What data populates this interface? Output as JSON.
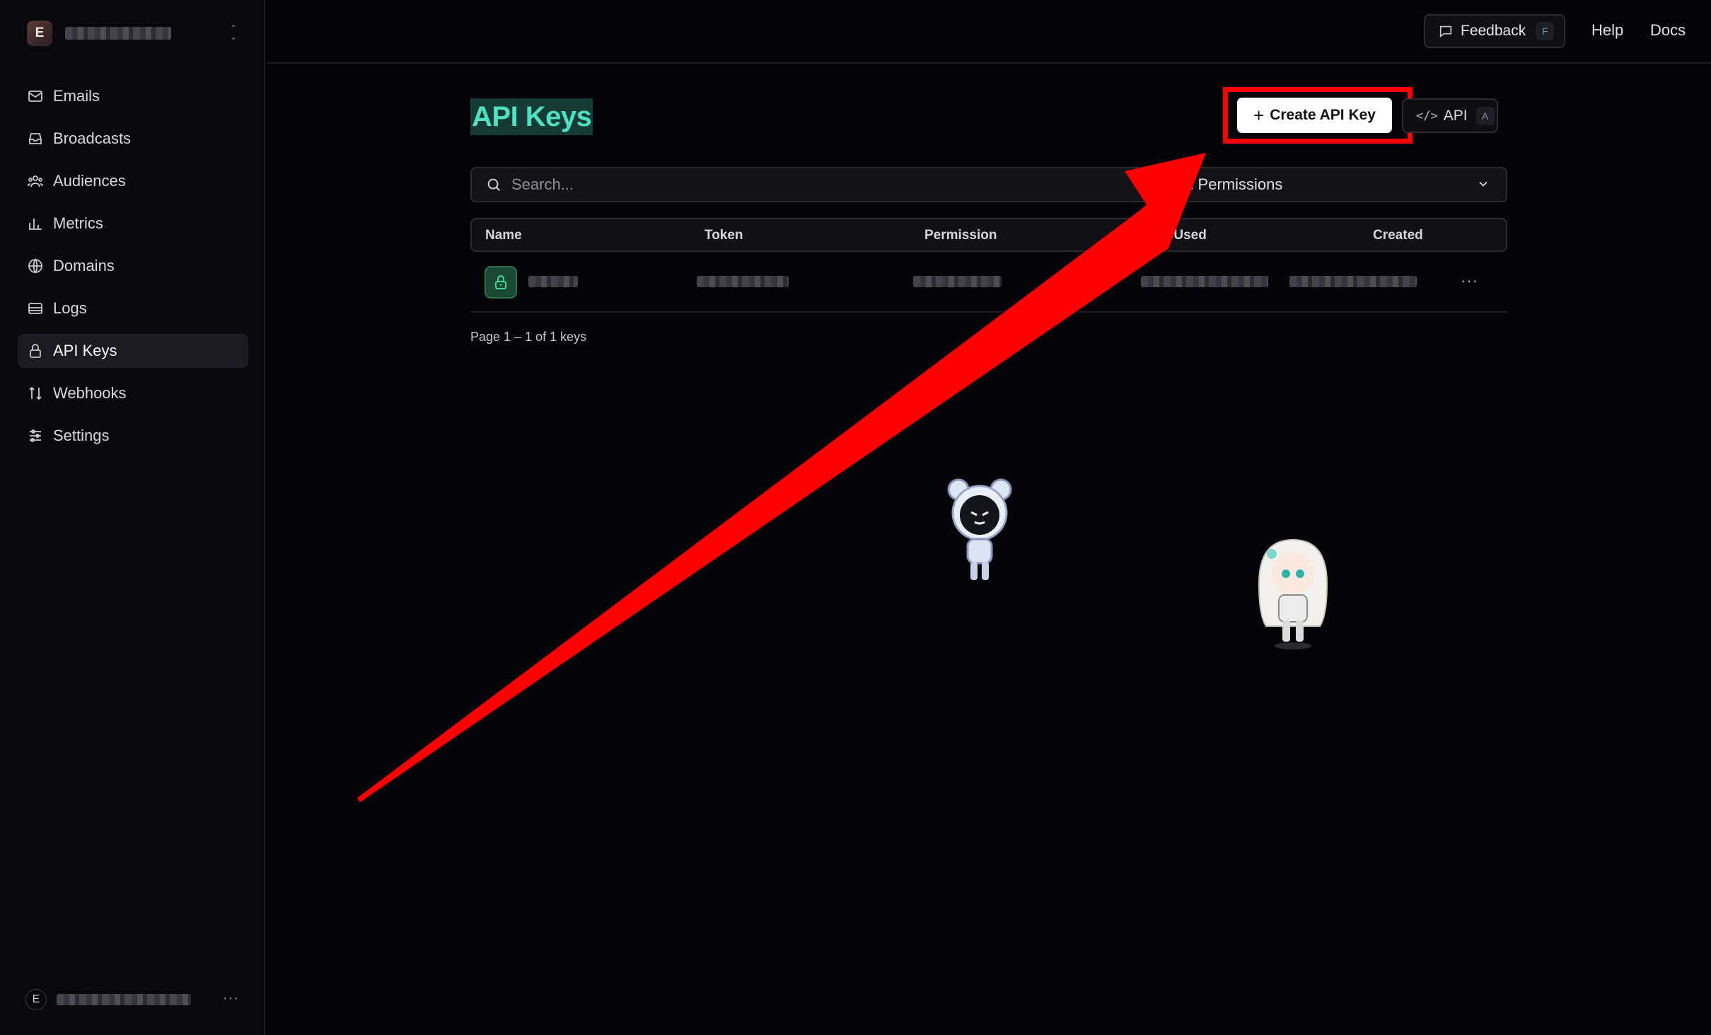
{
  "sidebar": {
    "team_initial": "E",
    "items": [
      {
        "label": "Emails",
        "icon": "mail-icon"
      },
      {
        "label": "Broadcasts",
        "icon": "inbox-icon"
      },
      {
        "label": "Audiences",
        "icon": "users-icon"
      },
      {
        "label": "Metrics",
        "icon": "bar-chart-icon"
      },
      {
        "label": "Domains",
        "icon": "globe-icon"
      },
      {
        "label": "Logs",
        "icon": "logs-icon"
      },
      {
        "label": "API Keys",
        "icon": "lock-icon",
        "active": true
      },
      {
        "label": "Webhooks",
        "icon": "webhook-arrows-icon"
      },
      {
        "label": "Settings",
        "icon": "sliders-icon"
      }
    ],
    "user_initial": "E",
    "user_more": "···"
  },
  "topbar": {
    "feedback_label": "Feedback",
    "feedback_key": "F",
    "help_label": "Help",
    "docs_label": "Docs"
  },
  "main": {
    "title": "API Keys",
    "create_button": "Create API Key",
    "api_button": "API",
    "api_key": "A",
    "search_placeholder": "Search...",
    "permissions_filter": "All Permissions",
    "table": {
      "columns": [
        "Name",
        "Token",
        "Permission",
        "Last Used",
        "Created"
      ]
    },
    "row_more": "···",
    "pager": "Page 1 – 1 of 1 keys"
  },
  "colors": {
    "accent": "#4fe0c0",
    "annotation": "#ff0000",
    "background": "#050509"
  }
}
